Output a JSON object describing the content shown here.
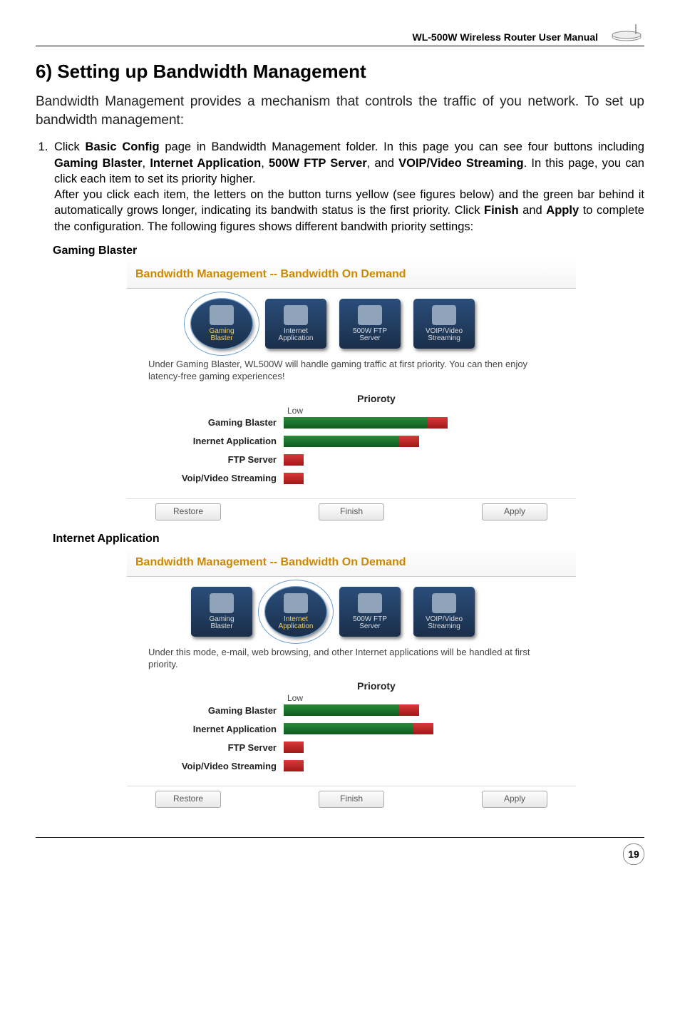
{
  "header": {
    "doc_title": "WL-500W Wireless Router User Manual"
  },
  "section": {
    "title": "6) Setting up Bandwidth Management",
    "intro": "Bandwidth Management provides a mechanism that controls the traffic of you network. To set up bandwidth management:",
    "step1_prefix": "Click ",
    "step1_bold1": "Basic Config",
    "step1_mid1": " page in Bandwidth Management folder. In this page you can see four buttons including ",
    "step1_bold2": "Gaming Blaster",
    "step1_sep1": ", ",
    "step1_bold3": "Internet Application",
    "step1_sep2": ", ",
    "step1_bold4": "500W FTP Server",
    "step1_sep3": ", and ",
    "step1_bold5": "VOIP/Video Streaming",
    "step1_mid2": ". In this page, you can click each item to set its priority higher.",
    "step1_line2a": "After you click each item, the letters on the button turns yellow (see figures below) and the green bar behind it automatically grows longer, indicating its bandwith status is the first priority. Click ",
    "step1_bold6": "Finish",
    "step1_and": " and ",
    "step1_bold7": "Apply",
    "step1_line2b": " to complete the configuration. The following figures shows different bandwith priority settings:"
  },
  "sub1": {
    "title": "Gaming Blaster"
  },
  "sub2": {
    "title": "Internet Application"
  },
  "ss1": {
    "title": "Bandwidth Management -- Bandwidth On Demand",
    "modes": {
      "gaming": {
        "l1": "Gaming",
        "l2": "Blaster"
      },
      "internet": {
        "l1": "Internet",
        "l2": "Application"
      },
      "ftp": {
        "l1": "500W FTP",
        "l2": "Server"
      },
      "voip": {
        "l1": "VOIP/Video",
        "l2": "Streaming"
      }
    },
    "desc": "Under Gaming Blaster, WL500W will handle gaming traffic at first priority. You can then enjoy latency-free gaming experiences!",
    "prio_title": "Prioroty",
    "low": "Low",
    "rows": {
      "gaming": "Gaming Blaster",
      "inet": "Inernet Application",
      "ftp": "FTP Server",
      "voip": "Voip/Video Streaming"
    },
    "buttons": {
      "restore": "Restore",
      "finish": "Finish",
      "apply": "Apply"
    }
  },
  "ss2": {
    "title": "Bandwidth Management -- Bandwidth On Demand",
    "modes": {
      "gaming": {
        "l1": "Gaming",
        "l2": "Blaster"
      },
      "internet": {
        "l1": "Internet",
        "l2": "Application"
      },
      "ftp": {
        "l1": "500W FTP",
        "l2": "Server"
      },
      "voip": {
        "l1": "VOIP/Video",
        "l2": "Streaming"
      }
    },
    "desc": "Under this mode, e-mail, web browsing, and other Internet applications will be handled at first priority.",
    "prio_title": "Prioroty",
    "low": "Low",
    "rows": {
      "gaming": "Gaming Blaster",
      "inet": "Inernet Application",
      "ftp": "FTP Server",
      "voip": "Voip/Video Streaming"
    },
    "buttons": {
      "restore": "Restore",
      "finish": "Finish",
      "apply": "Apply"
    }
  },
  "chart_data": [
    {
      "type": "bar",
      "title": "Prioroty",
      "xlabel": "Low",
      "categories": [
        "Gaming Blaster",
        "Inernet Application",
        "FTP Server",
        "Voip/Video Streaming"
      ],
      "values": [
        230,
        190,
        28,
        28
      ],
      "note": "Gaming Blaster mode selected; green bar = base, red tip segment on all"
    },
    {
      "type": "bar",
      "title": "Prioroty",
      "xlabel": "Low",
      "categories": [
        "Gaming Blaster",
        "Inernet Application",
        "FTP Server",
        "Voip/Video Streaming"
      ],
      "values": [
        190,
        210,
        28,
        28
      ],
      "note": "Internet Application mode selected; green bar = base, red tip segment on all"
    }
  ],
  "footer": {
    "page": "19"
  }
}
